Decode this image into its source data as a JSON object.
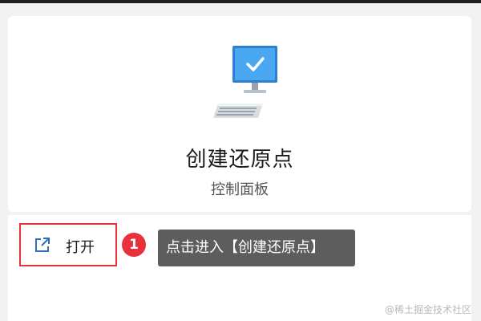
{
  "card": {
    "icon": "monitor-checkmark-icon",
    "title": "创建还原点",
    "subtitle": "控制面板"
  },
  "actions": {
    "open_icon": "open-external-icon",
    "open_label": "打开"
  },
  "annotation": {
    "step_number": "1",
    "tooltip_text": "点击进入【创建还原点】"
  },
  "watermark": "@稀土掘金技术社区",
  "colors": {
    "accent_red": "#e8313a",
    "tooltip_bg": "#5d5d5d",
    "monitor_blue": "#4aa8f0"
  }
}
